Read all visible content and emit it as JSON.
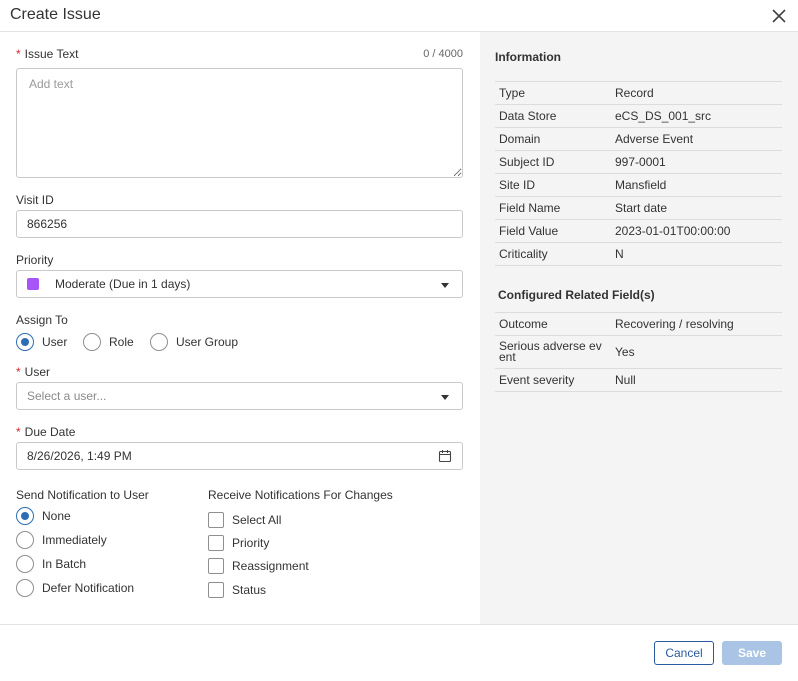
{
  "dialog": {
    "title": "Create Issue"
  },
  "issue_text": {
    "label": "Issue Text",
    "counter": "0 / 4000",
    "placeholder": "Add text"
  },
  "visit_id": {
    "label": "Visit ID",
    "value": "866256"
  },
  "priority": {
    "label": "Priority",
    "value": "Moderate (Due in 1 days)",
    "color": "#a855f7"
  },
  "assign_to": {
    "label": "Assign To",
    "options": [
      "User",
      "Role",
      "User Group"
    ],
    "selected": "User"
  },
  "user": {
    "label": "User",
    "placeholder": "Select a user..."
  },
  "due_date": {
    "label": "Due Date",
    "value": "8/26/2026, 1:49 PM"
  },
  "send_notification": {
    "label": "Send Notification to User",
    "options": [
      "None",
      "Immediately",
      "In Batch",
      "Defer Notification"
    ],
    "selected": "None"
  },
  "receive_notifications": {
    "label": "Receive Notifications For Changes",
    "options": [
      "Select All",
      "Priority",
      "Reassignment",
      "Status"
    ]
  },
  "information": {
    "title": "Information",
    "rows": [
      {
        "key": "Type",
        "value": "Record"
      },
      {
        "key": "Data Store",
        "value": "eCS_DS_001_src"
      },
      {
        "key": "Domain",
        "value": "Adverse Event"
      },
      {
        "key": "Subject ID",
        "value": "997-0001"
      },
      {
        "key": "Site ID",
        "value": "Mansfield"
      },
      {
        "key": "Field Name",
        "value": "Start date"
      },
      {
        "key": "Field Value",
        "value": "2023-01-01T00:00:00"
      },
      {
        "key": "Criticality",
        "value": "N"
      }
    ]
  },
  "related": {
    "title": "Configured Related Field(s)",
    "rows": [
      {
        "key": "Outcome",
        "value": "Recovering / resolving"
      },
      {
        "key": "Serious adverse ev ent",
        "value": "Yes"
      },
      {
        "key": "Event severity",
        "value": "Null"
      }
    ]
  },
  "footer": {
    "cancel_label": "Cancel",
    "save_label": "Save"
  },
  "colors": {
    "accent": "#2d6db5",
    "required": "#d8262c",
    "save_disabled": "#a9c4e4"
  }
}
